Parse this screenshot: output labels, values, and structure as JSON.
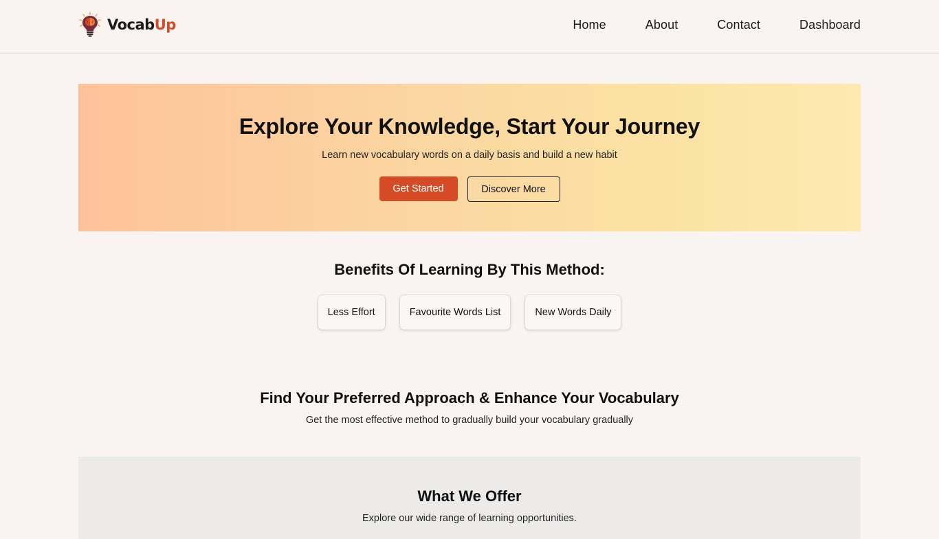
{
  "brand": {
    "name_main": "Vocab",
    "name_accent": "Up",
    "logo_icon": "lightbulb-brain-icon",
    "accent_color": "#d54b26"
  },
  "nav": {
    "links": [
      "Home",
      "About",
      "Contact",
      "Dashboard"
    ]
  },
  "hero": {
    "title": "Explore Your Knowledge, Start Your Journey",
    "subtitle": "Learn new vocabulary words on a daily basis and build a new habit",
    "primary_button": "Get Started",
    "secondary_button": "Discover More",
    "gradient_start": "#fec29a",
    "gradient_end": "#fdeaaf"
  },
  "benefits": {
    "title": "Benefits Of Learning By This Method:",
    "items": [
      "Less Effort",
      "Favourite Words List",
      "New Words Daily"
    ]
  },
  "approach": {
    "title": "Find Your Preferred Approach & Enhance Your Vocabulary",
    "subtitle": "Get the most effective method to gradually build your vocabulary gradually"
  },
  "offer": {
    "title": "What We Offer",
    "subtitle": "Explore our wide range of learning opportunities."
  }
}
